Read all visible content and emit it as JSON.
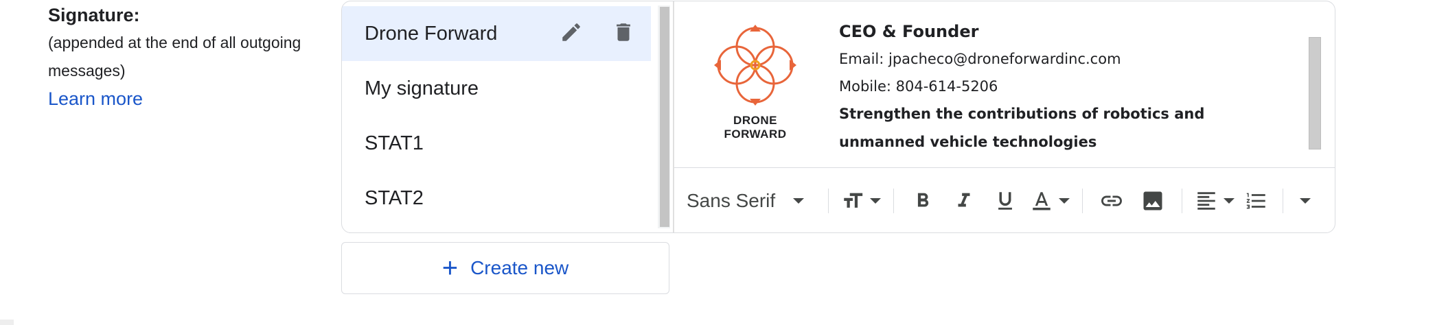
{
  "signature_section": {
    "title": "Signature:",
    "description": "(appended at the end of all outgoing messages)",
    "learn_more": "Learn more"
  },
  "signatures": [
    {
      "name": "Drone Forward",
      "selected": true
    },
    {
      "name": "My signature",
      "selected": false
    },
    {
      "name": "STAT1",
      "selected": false
    },
    {
      "name": "STAT2",
      "selected": false
    }
  ],
  "item_actions": {
    "edit_icon": "pencil-icon",
    "delete_icon": "trash-icon"
  },
  "signature_preview": {
    "logo_text": "DRONE FORWARD",
    "role": "CEO & Founder",
    "email": "Email: jpacheco@droneforwardinc.com",
    "mobile": "Mobile: 804-614-5206",
    "tagline": "Strengthen the contributions of robotics and unmanned vehicle technologies"
  },
  "toolbar": {
    "font": "Sans Serif",
    "buttons": [
      "font-size-icon",
      "bold-icon",
      "italic-icon",
      "underline-icon",
      "text-color-icon",
      "link-icon",
      "image-icon",
      "align-icon",
      "numbered-list-icon",
      "more-formatting-icon"
    ]
  },
  "create_new": {
    "label": "Create new"
  },
  "colors": {
    "accent": "#1a56c9",
    "selected_bg": "#e8f0fe",
    "logo_orange": "#e8653a"
  }
}
